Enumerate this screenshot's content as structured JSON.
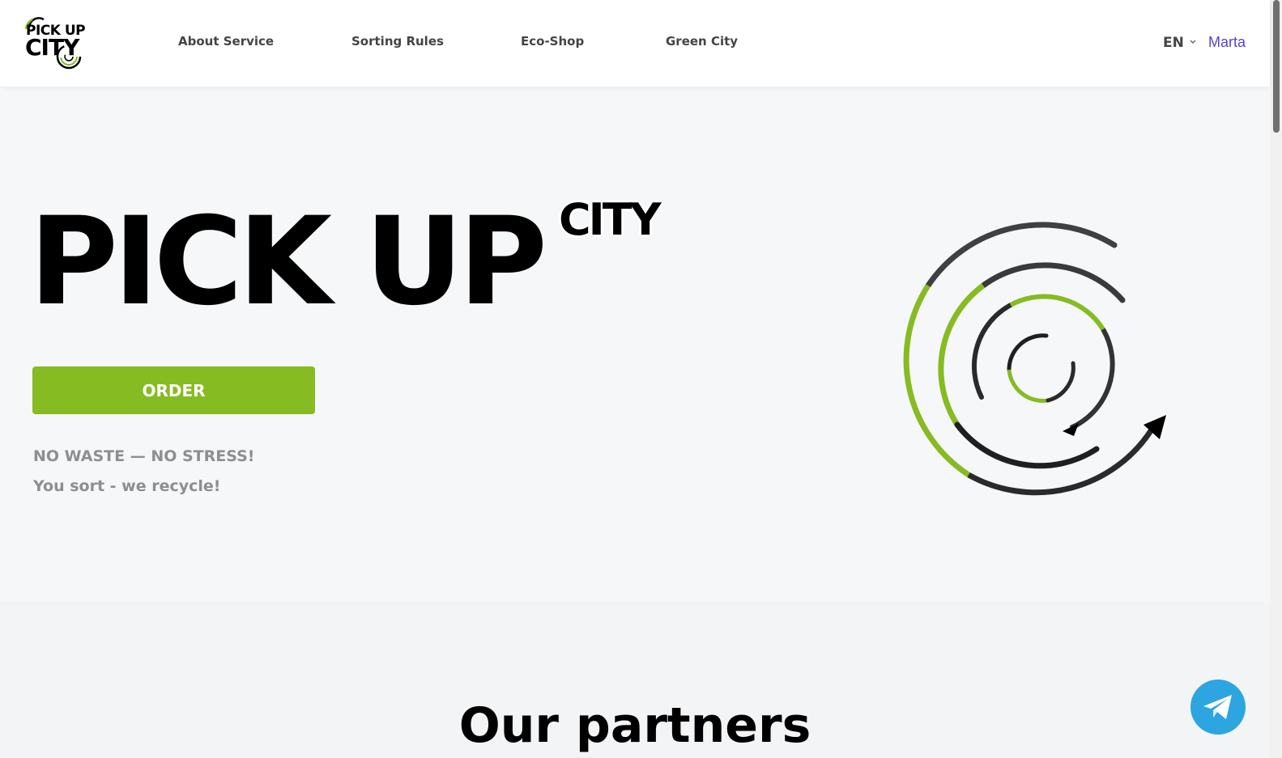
{
  "header": {
    "logo_line1": "PICK UP",
    "logo_line2": "CITY",
    "nav": [
      {
        "label": "About Service"
      },
      {
        "label": "Sorting Rules"
      },
      {
        "label": "Eco-Shop"
      },
      {
        "label": "Green City"
      }
    ],
    "language": "EN",
    "user_name": "Marta"
  },
  "hero": {
    "title": "PICK UP",
    "title_sup": "CITY",
    "order_label": "ORDER",
    "slogan_line1": "NO WASTE — NO STRESS!",
    "slogan_line2": "You sort - we recycle!"
  },
  "partners": {
    "title": "Our partners"
  },
  "icons": {
    "logo": "pick-up-city-logo",
    "hero_graphic": "recycle-rings-icon",
    "language_dropdown": "chevron-down-icon",
    "chat": "telegram-icon"
  },
  "colors": {
    "accent_green": "#86bb22",
    "user_link": "#5b43c4",
    "telegram_blue": "#2ca5e0"
  }
}
